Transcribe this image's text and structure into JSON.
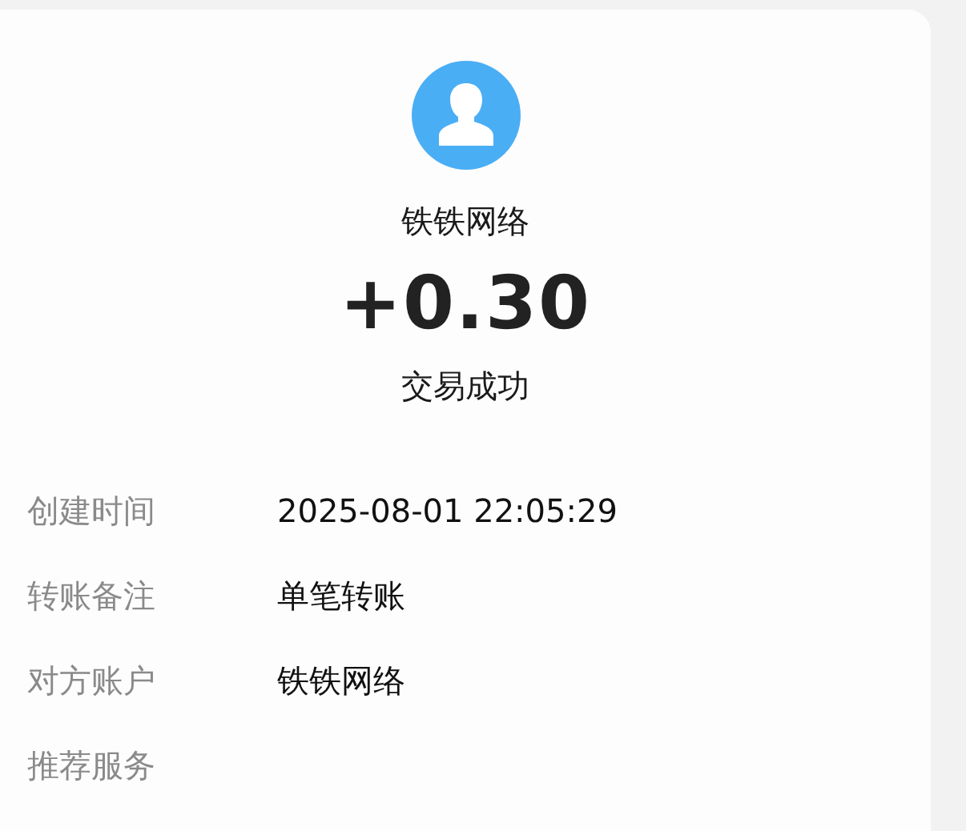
{
  "payee": {
    "name": "铁铁网络"
  },
  "amount": "+0.30",
  "status": "交易成功",
  "details": [
    {
      "label": "创建时间",
      "value": "2025-08-01 22:05:29"
    },
    {
      "label": "转账备注",
      "value": "单笔转账"
    },
    {
      "label": "对方账户",
      "value": "铁铁网络"
    },
    {
      "label": "推荐服务"
    }
  ]
}
